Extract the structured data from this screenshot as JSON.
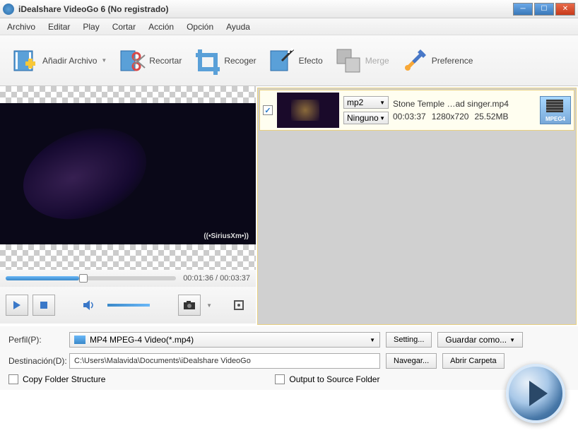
{
  "window": {
    "title": "iDealshare VideoGo 6 (No registrado)"
  },
  "menu": {
    "items": [
      "Archivo",
      "Editar",
      "Play",
      "Cortar",
      "Acción",
      "Opción",
      "Ayuda"
    ]
  },
  "toolbar": {
    "add": "Añadir Archivo",
    "trim": "Recortar",
    "crop": "Recoger",
    "effect": "Efecto",
    "merge": "Merge",
    "pref": "Preference"
  },
  "player": {
    "timecode": "00:01:36 / 00:03:37",
    "watermark": "((•SiriusXm•))"
  },
  "list": {
    "item": {
      "checked": "✓",
      "format": "mp2",
      "subtitle": "Ninguno",
      "filename": "Stone Temple …ad singer.mp4",
      "duration": "00:03:37",
      "resolution": "1280x720",
      "size": "25.52MB",
      "badge": "MPEG4"
    }
  },
  "bottom": {
    "profile_label": "Perfil(P):",
    "profile_value": "MP4 MPEG-4 Video(*.mp4)",
    "setting": "Setting...",
    "saveas": "Guardar como...",
    "dest_label": "Destinación(D):",
    "dest_value": "C:\\Users\\Malavida\\Documents\\iDealshare VideoGo",
    "browse": "Navegar...",
    "open_folder": "Abrir Carpeta",
    "copy_folder": "Copy Folder Structure",
    "output_source": "Output to Source Folder"
  }
}
